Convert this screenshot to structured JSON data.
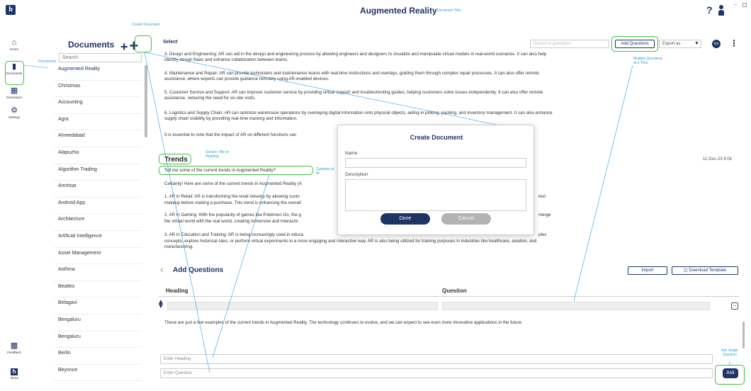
{
  "app": {
    "title": "Augmented Reality",
    "logo_letter": "h"
  },
  "annotations": {
    "create_document": "Create Document",
    "document_title": "Document Title",
    "documents": "Documents",
    "section_title": "Section Title or Heading",
    "question_to_ai": "Question to AI",
    "multiple_questions": "Multiple Questions at a Time",
    "ask_single": "Ask Single Question"
  },
  "nav": {
    "home": "Home",
    "documents": "Documents",
    "generators": "Generators",
    "settings": "Settings",
    "feedback": "Feedback",
    "about": "About"
  },
  "docs_panel": {
    "title": "Documents",
    "search_placeholder": "Search",
    "items": [
      "Augmented Reality",
      "Christmas",
      "Accounting",
      "Agra",
      "Ahmedabad",
      "Alapuzha",
      "Algorithm Trading",
      "Amritsar",
      "Android App",
      "Architecture",
      "Artificial Intelligence",
      "Asset Management",
      "Asthma",
      "Beatles",
      "Belagavi",
      "Bengaluru",
      "Bengaluru",
      "Berlin",
      "Beyonce"
    ]
  },
  "toolbar": {
    "select_label": "Select",
    "search_placeholder": "Search in questions",
    "add_questions": "Add Questions",
    "export_as": "Export as",
    "go": "Go"
  },
  "content": {
    "p1": "3. Design and Engineering: AR can aid in the design and engineering process by allowing engineers and designers to visualize and manipulate virtual models in real-world scenarios. It can also help identify design flaws and enhance collaboration between teams.",
    "p2": "4. Maintenance and Repair: AR can provide technicians and maintenance teams with real-time instructions and overlays, guiding them through complex repair processes. It can also offer remote assistance, where experts can provide guidance remotely using AR-enabled devices.",
    "p3": "5. Customer Service and Support: AR can improve customer service by providing virtual support and troubleshooting guides, helping customers solve issues independently. It can also offer remote assistance, reducing the need for on-site visits.",
    "p4": "6. Logistics and Supply Chain: AR can optimize warehouse operations by overlaying digital information onto physical objects, aiding in picking, packing, and inventory management. It can also enhance supply chain visibility by providing real-time tracking and information.",
    "p5": "It is essential to note that the impact of AR on different functions can",
    "section_title": "Trends",
    "date": "11-Dec-23 9:06",
    "question": "Tell me some of the current trends in Augmented Reality?",
    "a1": "Certainly! Here are some of the current trends in Augmented Reality (A",
    "a2": "1. AR in Retail: AR is transforming the retail industry by allowing custo",
    "a2_end": "test",
    "a2b": "makeup before making a purchase. This trend is enhancing the overall",
    "a3": "2. AR in Gaming: With the popularity of games like Pokémon Go, the g",
    "a3_end": "merge",
    "a3b": "the virtual world with the real world, creating immersive and interactiv",
    "a4": "3. AR in Education and Training: AR is being increasingly used in educa",
    "a4_end": "plex",
    "a4b": "concepts, explore historical sites, or perform virtual experiments in a more engaging and interactive way. AR is also being utilized for training purposes in industries like healthcare, aviation, and manufacturing.",
    "closing": "These are just a few examples of the current trends in Augmented Reality. The technology continues to evolve, and we can expect to see even more innovative applications in the future."
  },
  "add_questions": {
    "title": "Add Questions",
    "import": "Import",
    "download_template": "Download Template",
    "col_heading": "Heading",
    "col_question": "Question",
    "enter_heading": "Enter Heading",
    "enter_question": "Enter Question",
    "ask": "Ask"
  },
  "modal": {
    "title": "Create Document",
    "name_label": "Name",
    "description_label": "Description",
    "done": "Done",
    "cancel": "Cancel"
  },
  "colors": {
    "brand": "#1e3466",
    "annotation": "#29a0e0",
    "highlight": "#3fbf3f"
  }
}
